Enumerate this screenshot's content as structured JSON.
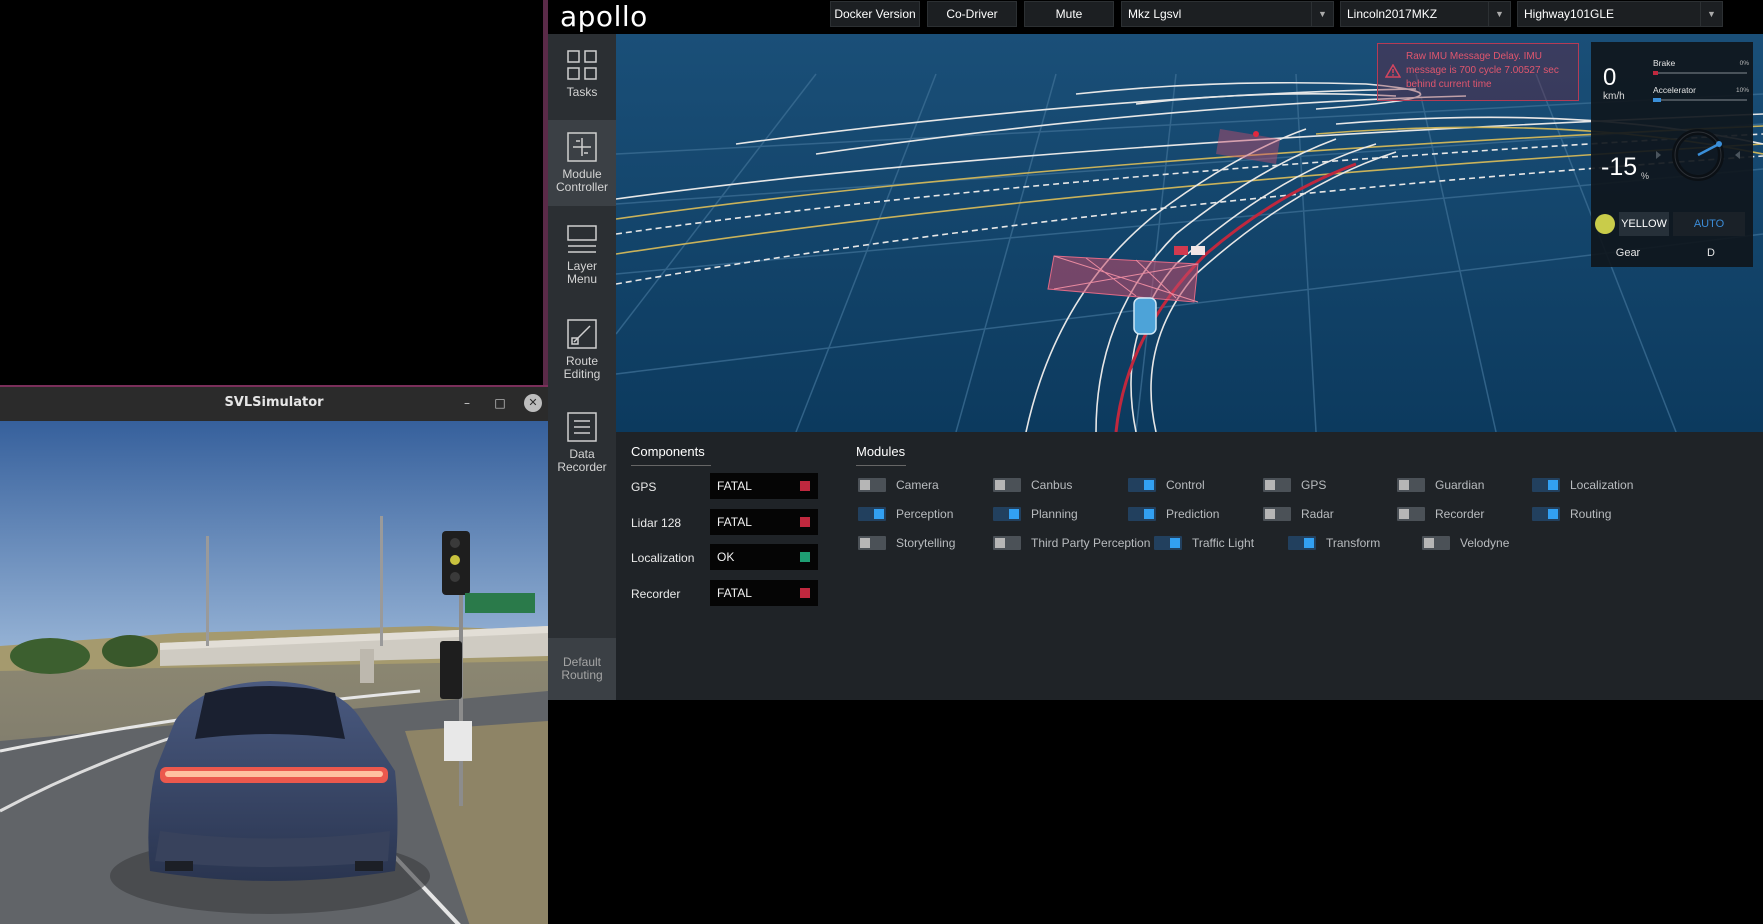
{
  "svl": {
    "title": "SVLSimulator",
    "minimize_glyph": "–",
    "maximize_glyph": "□",
    "close_glyph": "✕"
  },
  "header": {
    "logo": "apollo",
    "docker_version": "Docker Version",
    "co_driver": "Co-Driver",
    "mute": "Mute",
    "mode_select": "Mkz Lgsvl",
    "vehicle_select": "Lincoln2017MKZ",
    "map_select": "Highway101GLE"
  },
  "sidebar": {
    "items": [
      {
        "label_1": "Tasks",
        "label_2": ""
      },
      {
        "label_1": "Module",
        "label_2": "Controller"
      },
      {
        "label_1": "Layer",
        "label_2": "Menu"
      },
      {
        "label_1": "Route",
        "label_2": "Editing"
      },
      {
        "label_1": "Data",
        "label_2": "Recorder"
      }
    ],
    "default_routing_1": "Default",
    "default_routing_2": "Routing"
  },
  "scene": {
    "alert": "Raw IMU Message Delay. IMU message is 700 cycle 7.00527 sec behind current time"
  },
  "dashboard": {
    "speed": "0",
    "speed_unit": "km/h",
    "brake_label": "Brake",
    "brake_pct": "0%",
    "brake_level": 0.05,
    "accel_label": "Accelerator",
    "accel_pct": "10%",
    "accel_level": 0.08,
    "steering": "-15",
    "steering_unit": "%",
    "traffic_light": "YELLOW",
    "drive_mode": "AUTO",
    "gear_label": "Gear",
    "gear_value": "D"
  },
  "components": {
    "title": "Components",
    "rows": [
      {
        "name": "GPS",
        "status": "FATAL",
        "color": "#c0283e"
      },
      {
        "name": "Lidar 128",
        "status": "FATAL",
        "color": "#c0283e"
      },
      {
        "name": "Localization",
        "status": "OK",
        "color": "#1e9e73"
      },
      {
        "name": "Recorder",
        "status": "FATAL",
        "color": "#c0283e"
      }
    ]
  },
  "modules": {
    "title": "Modules",
    "items": [
      {
        "label": "Camera",
        "on": false
      },
      {
        "label": "Canbus",
        "on": false
      },
      {
        "label": "Control",
        "on": true
      },
      {
        "label": "GPS",
        "on": false
      },
      {
        "label": "Guardian",
        "on": false
      },
      {
        "label": "Localization",
        "on": true
      },
      {
        "label": "Perception",
        "on": true
      },
      {
        "label": "Planning",
        "on": true
      },
      {
        "label": "Prediction",
        "on": true
      },
      {
        "label": "Radar",
        "on": false
      },
      {
        "label": "Recorder",
        "on": false
      },
      {
        "label": "Routing",
        "on": true
      },
      {
        "label": "Storytelling",
        "on": false
      },
      {
        "label": "Third Party Perception",
        "on": false
      },
      {
        "label": "Traffic Light",
        "on": true
      },
      {
        "label": "Transform",
        "on": true
      },
      {
        "label": "Velodyne",
        "on": false
      }
    ]
  }
}
